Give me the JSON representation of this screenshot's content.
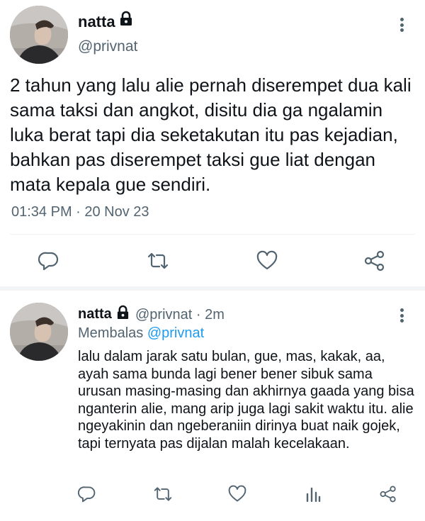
{
  "main_tweet": {
    "author_name": "natta",
    "author_handle": "@privnat",
    "text": "2 tahun yang lalu alie pernah diserempet dua kali sama taksi dan angkot, disitu dia ga ngalamin luka berat tapi dia seketakutan itu pas kejadian, bahkan pas diserempet taksi gue liat dengan mata kepala gue sendiri.",
    "timestamp": "01:34 PM · 20 Nov 23",
    "icons": [
      "reply-icon",
      "retweet-icon",
      "like-icon",
      "share-icon"
    ]
  },
  "reply_tweet": {
    "author_name": "natta",
    "author_handle": "@privnat · 2m",
    "replying_prefix": "Membalas",
    "replying_to": "@privnat",
    "text": "lalu dalam jarak satu bulan, gue, mas, kakak, aa, ayah sama bunda lagi bener bener sibuk sama urusan masing-masing dan akhirnya gaada yang bisa nganterin alie, mang arip juga lagi sakit waktu itu. alie ngeyakinin dan ngeberaniin dirinya buat naik gojek, tapi ternyata pas dijalan malah kecelakaan.",
    "icons": [
      "reply-icon",
      "retweet-icon",
      "like-icon",
      "analytics-icon",
      "share-icon"
    ]
  },
  "colors": {
    "text_primary": "#0f1419",
    "text_secondary": "#536471",
    "accent": "#1d9bf0",
    "icon_gray": "#536471"
  }
}
